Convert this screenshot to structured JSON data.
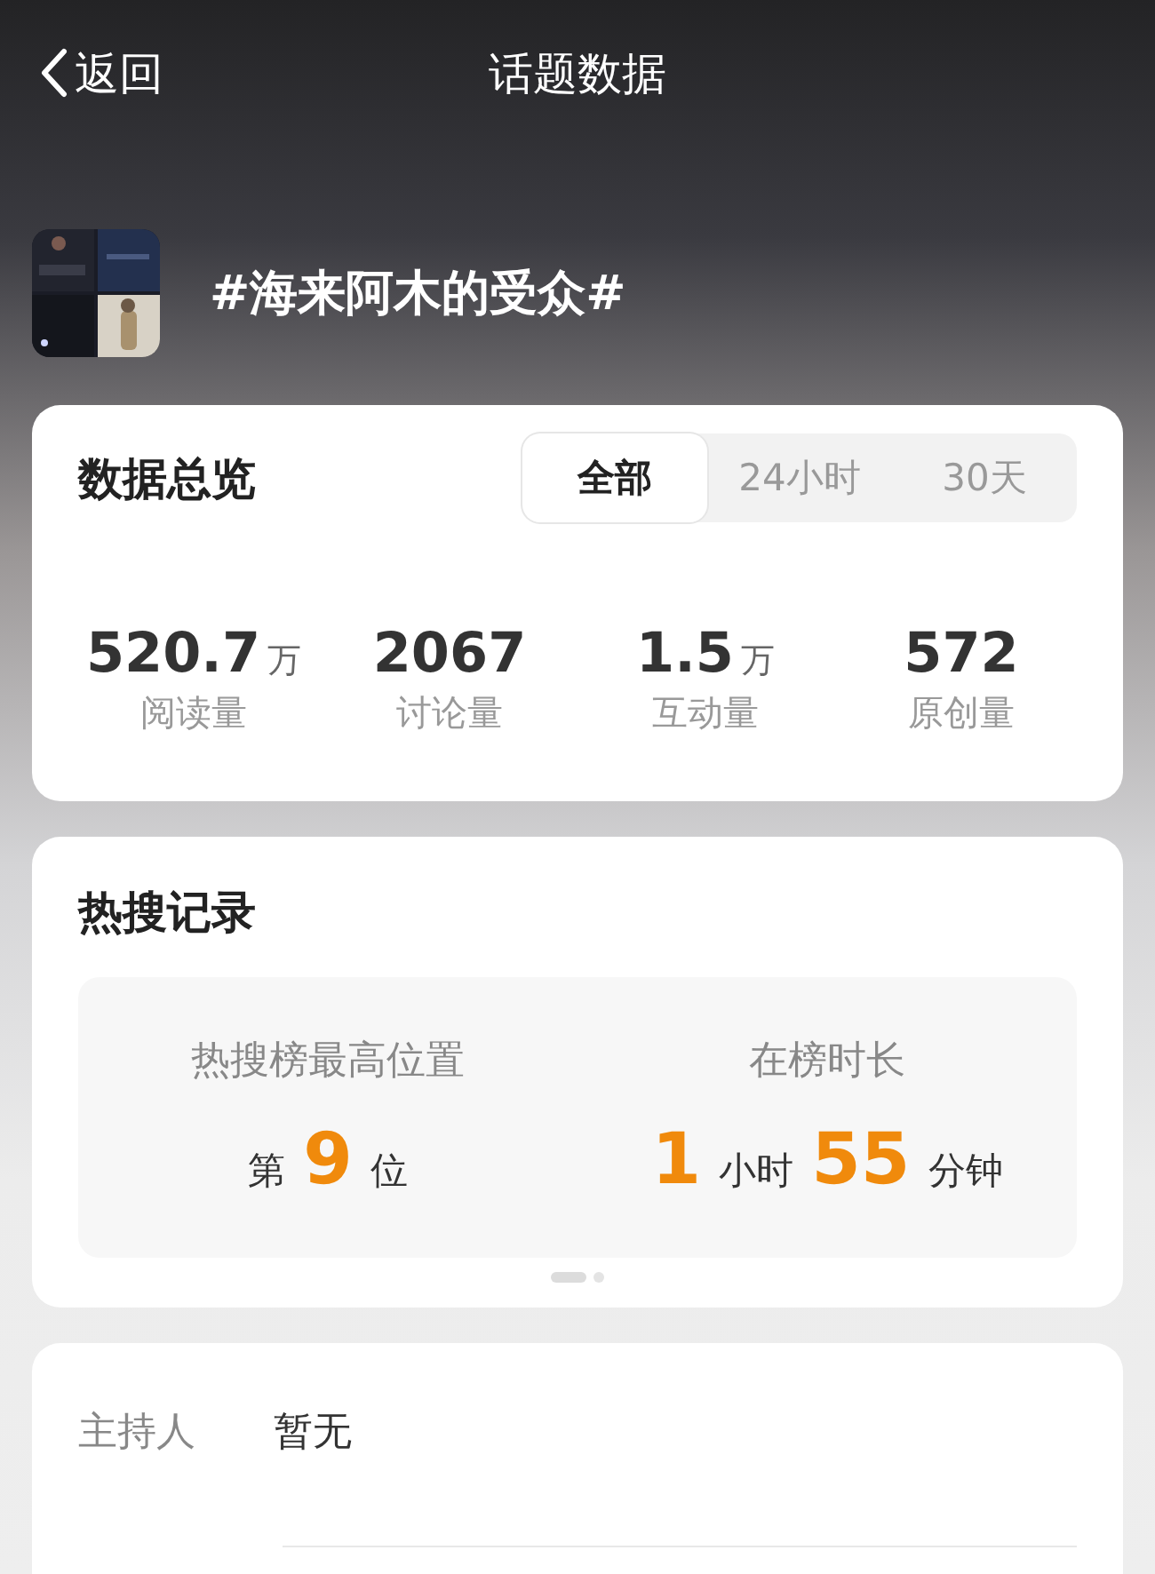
{
  "nav": {
    "back_label": "返回",
    "title": "话题数据"
  },
  "topic": {
    "name": "#海来阿木的受众#"
  },
  "overview": {
    "title": "数据总览",
    "tabs": [
      {
        "label": "全部",
        "selected": true
      },
      {
        "label": "24小时",
        "selected": false
      },
      {
        "label": "30天",
        "selected": false
      }
    ],
    "stats": [
      {
        "value": "520.7",
        "unit": "万",
        "label": "阅读量"
      },
      {
        "value": "2067",
        "label": "讨论量"
      },
      {
        "value": "1.5",
        "unit": "万",
        "label": "互动量"
      },
      {
        "value": "572",
        "label": "原创量"
      }
    ]
  },
  "hot_search": {
    "title": "热搜记录",
    "blocks": [
      {
        "label": "热搜榜最高位置",
        "parts": [
          {
            "kind": "unit",
            "text": "第"
          },
          {
            "kind": "number",
            "text": "9"
          },
          {
            "kind": "unit",
            "text": "位"
          }
        ]
      },
      {
        "label": "在榜时长",
        "parts": [
          {
            "kind": "number",
            "text": "1"
          },
          {
            "kind": "unit",
            "text": "小时"
          },
          {
            "kind": "number",
            "text": "55"
          },
          {
            "kind": "unit",
            "text": "分钟"
          }
        ]
      }
    ],
    "pager": [
      {
        "selected": true
      },
      {
        "selected": false
      }
    ]
  },
  "info": {
    "rows": [
      {
        "label": "主持人",
        "value": "暂无"
      }
    ]
  }
}
